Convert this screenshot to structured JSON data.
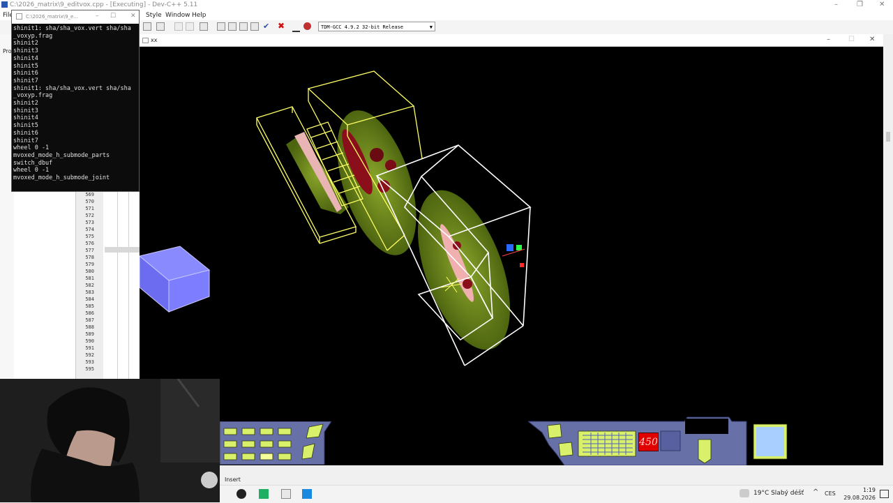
{
  "ide": {
    "title": "C:\\2026_matrix\\9_editvox.cpp - [Executing] - Dev-C++ 5.11",
    "menu": [
      {
        "label": "File"
      },
      {
        "label": "Style"
      },
      {
        "label": "Window"
      },
      {
        "label": "Help"
      }
    ],
    "compiler": "TDM-GCC 4.9.2 32-bit Release",
    "left_label": "Pro",
    "line_numbers": [
      "569",
      "570",
      "571",
      "572",
      "573",
      "574",
      "575",
      "576",
      "577",
      "578",
      "579",
      "580",
      "581",
      "582",
      "583",
      "584",
      "585",
      "586",
      "587",
      "588",
      "589",
      "590",
      "591",
      "592",
      "593",
      "595"
    ]
  },
  "console": {
    "title": "C:\\2026_matrix\\9_e...",
    "lines": [
      "shinit1: sha/sha_vox.vert sha/sha",
      "_voxyp.frag",
      "shinit2",
      "shinit3",
      "shinit4",
      "shinit5",
      "shinit6",
      "shinit7",
      "shinit1: sha/sha_vox.vert sha/sha",
      "_voxyp.frag",
      "shinit2",
      "shinit3",
      "shinit4",
      "shinit5",
      "shinit6",
      "shinit7",
      "wheel 0 -1",
      "mvoxed_mode_h_submode_parts",
      "switch_dbuf",
      "wheel 0 -1",
      "mvoxed_mode_h_submode_joint"
    ]
  },
  "game": {
    "title": "xx",
    "hud_counter": "450"
  },
  "statusbar": {
    "mode": "Insert"
  },
  "taskbar": {
    "weather": "19°C  Slabý déšť",
    "language": "CES",
    "time": "1:19",
    "date": "29.08.2026"
  },
  "colors": {
    "wire_yellow": "#ffff66",
    "wire_white": "#ffffff",
    "voxel_green": "#6f8a1c",
    "voxel_red": "#8a0f1a",
    "voxel_pink": "#f0b0b0",
    "blue_box": "#7d7dff",
    "hud_panel": "#6870a8",
    "hud_accent": "#d9f06a",
    "counter_red": "#e00000"
  }
}
